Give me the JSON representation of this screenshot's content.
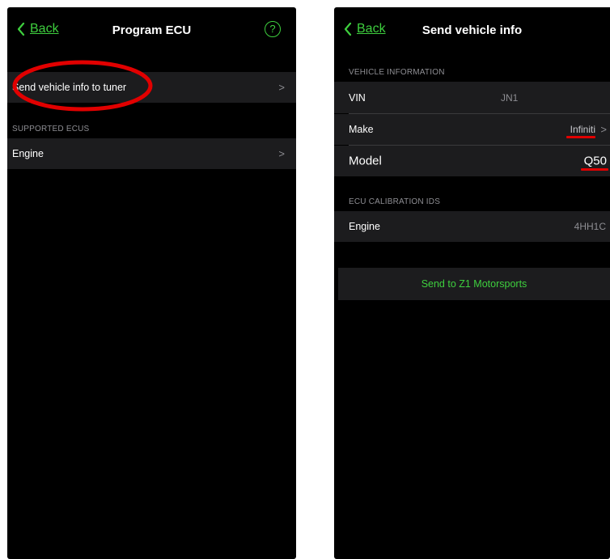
{
  "left_screen": {
    "back_label": "Back",
    "title": "Program ECU",
    "help_label": "?",
    "send_row_label": "Send vehicle info to tuner",
    "section_header": "SUPPORTED ECUS",
    "engine_row_label": "Engine",
    "chevron": ">"
  },
  "right_screen": {
    "back_label": "Back",
    "title": "Send vehicle info",
    "vehicle_section": "VEHICLE INFORMATION",
    "vin_label": "VIN",
    "vin_value": "JN1",
    "make_label": "Make",
    "make_value": "Infiniti",
    "model_label": "Model",
    "model_value": "Q50",
    "ecu_section": "ECU CALIBRATION IDS",
    "engine_label": "Engine",
    "engine_value": "4HH1C",
    "send_button": "Send to Z1 Motorsports",
    "chevron": ">"
  },
  "colors": {
    "accent": "#3ecf3e",
    "annotation": "#e10000",
    "cell": "#1c1c1e",
    "background": "#000000"
  }
}
